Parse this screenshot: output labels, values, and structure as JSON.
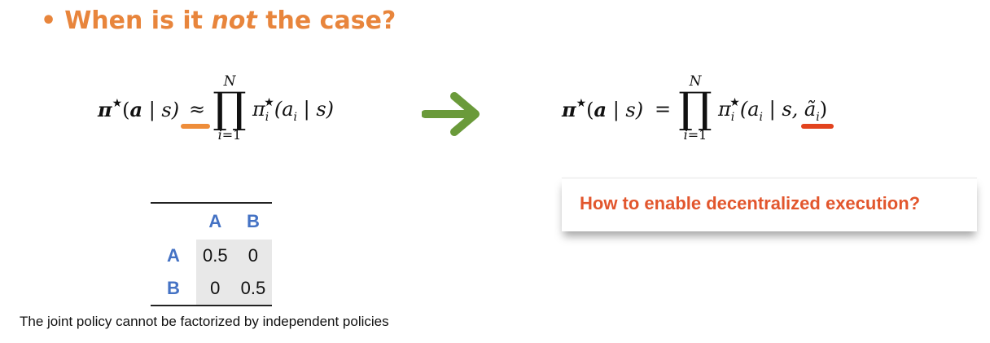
{
  "heading": {
    "bullet": "•",
    "prefix": "When is it ",
    "emphasis": "not",
    "suffix": " the case?"
  },
  "equation_left": {
    "lhs_pi": "π",
    "lhs_star": "★",
    "lhs_args_open": "(",
    "lhs_a": "a",
    "lhs_bar_s": " | s)",
    "relation": "≈",
    "prod_upper": "N",
    "prod_symbol": "∏",
    "prod_lower_var": "i",
    "prod_lower_rest": "=1",
    "rhs_pi": "π",
    "rhs_sub": "i",
    "rhs_star": "★",
    "rhs_args": "(a",
    "rhs_args_sub": "i",
    "rhs_args_end": " | s)"
  },
  "equation_right": {
    "lhs_pi": "π",
    "lhs_star": "★",
    "lhs_args_open": "(",
    "lhs_a": "a",
    "lhs_bar_s": " | s)",
    "relation": "=",
    "prod_upper": "N",
    "prod_symbol": "∏",
    "prod_lower_var": "i",
    "prod_lower_rest": "=1",
    "rhs_pi": "π",
    "rhs_sub": "i",
    "rhs_star": "★",
    "rhs_args": "(a",
    "rhs_args_sub": "i",
    "rhs_args_mid": " | s, ",
    "rhs_tilde": "ã",
    "rhs_tilde_sub": "i",
    "rhs_close": ")"
  },
  "callout": {
    "text": "How to enable decentralized execution?"
  },
  "matrix": {
    "col_headers": [
      "A",
      "B"
    ],
    "rows": [
      {
        "label": "A",
        "values": [
          "0.5",
          "0"
        ]
      },
      {
        "label": "B",
        "values": [
          "0",
          "0.5"
        ]
      }
    ]
  },
  "caption": "The joint policy cannot be factorized by independent policies",
  "colors": {
    "heading": "#e8853c",
    "callout_text": "#e2562d",
    "arrow": "#6a9a3a",
    "matrix_labels": "#4472c4",
    "highlight_left": "#ee8d3a",
    "highlight_right": "#e2431e"
  }
}
